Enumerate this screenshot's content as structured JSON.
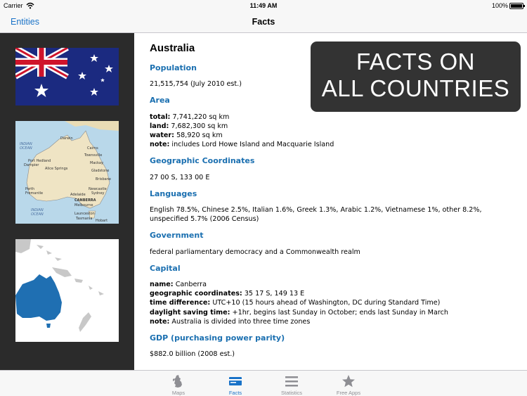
{
  "status_bar": {
    "carrier": "Carrier",
    "time": "11:49 AM",
    "battery": "100%"
  },
  "nav": {
    "back_label": "Entities",
    "title": "Facts"
  },
  "country": "Australia",
  "promo": {
    "line1": "FACTS ON",
    "line2": "ALL COUNTRIES"
  },
  "sections": {
    "population": {
      "heading": "Population",
      "value": "21,515,754 (July 2010 est.)"
    },
    "area": {
      "heading": "Area",
      "total_label": "total:",
      "total": "7,741,220 sq km",
      "land_label": "land:",
      "land": "7,682,300 sq km",
      "water_label": "water:",
      "water": "58,920 sq km",
      "note_label": "note:",
      "note": "includes Lord Howe Island and Macquarie Island"
    },
    "coordinates": {
      "heading": "Geographic Coordinates",
      "value": "27 00 S, 133 00 E"
    },
    "languages": {
      "heading": "Languages",
      "value": "English 78.5%, Chinese 2.5%, Italian 1.6%, Greek 1.3%, Arabic 1.2%, Vietnamese 1%, other 8.2%, unspecified 5.7% (2006 Census)"
    },
    "government": {
      "heading": "Government",
      "value": "federal parliamentary democracy and a Commonwealth realm"
    },
    "capital": {
      "heading": "Capital",
      "name_label": "name:",
      "name": "Canberra",
      "coords_label": "geographic coordinates:",
      "coords": "35 17 S, 149 13 E",
      "timediff_label": "time difference:",
      "timediff": "UTC+10 (15 hours ahead of Washington, DC during Standard Time)",
      "dst_label": "daylight saving time:",
      "dst": "+1hr, begins last Sunday in October; ends last Sunday in March",
      "note_label": "note:",
      "note": "Australia is divided into three time zones"
    },
    "gdp": {
      "heading": "GDP (purchasing power parity)",
      "value": "$882.0 billion (2008 est.)"
    }
  },
  "map_labels": {
    "ocean1": "INDIAN",
    "ocean1b": "OCEAN",
    "ocean2": "INDIAN",
    "ocean2b": "OCEAN",
    "darwin": "Darwin",
    "cairns": "Cairns",
    "townsville": "Townsville",
    "mackay": "Mackay",
    "gladstone": "Gladstone",
    "brisbane": "Brisbane",
    "port_hedland": "Port Hedland",
    "dampier": "Dampier",
    "alice": "Alice Springs",
    "perth": "Perth",
    "fremantle": "Fremantle",
    "adelaide": "Adelaide",
    "newcastle": "Newcastle",
    "sydney": "Sydney",
    "canberra": "CANBERRA",
    "melbourne": "Melbourne",
    "launceston": "Launceston",
    "hobart": "Hobart",
    "tasmania": "Tasmania"
  },
  "tabs": [
    {
      "label": "Maps",
      "icon": "maps-icon",
      "active": false
    },
    {
      "label": "Facts",
      "icon": "facts-icon",
      "active": true
    },
    {
      "label": "Statistics",
      "icon": "statistics-icon",
      "active": false
    },
    {
      "label": "Free Apps",
      "icon": "star-icon",
      "active": false
    }
  ],
  "colors": {
    "accent": "#1a73c8",
    "heading": "#1a6fb0",
    "sidebar": "#2b2b2b",
    "banner": "#333333",
    "locator_highlight": "#1f6fb2"
  }
}
